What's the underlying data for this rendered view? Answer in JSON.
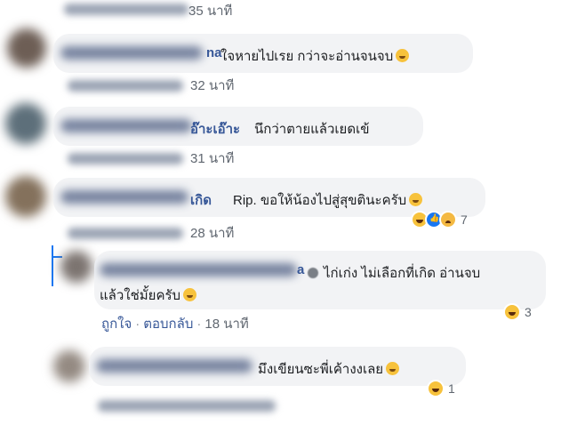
{
  "comments": [
    {
      "name_tail": "",
      "text": "",
      "time_fragment": "35 นาที"
    },
    {
      "name_tail": "na",
      "text": "ใจหายไปเรย กว่าจะอ่านจนจบ",
      "time_fragment": "32 นาที"
    },
    {
      "name_tail": "อ๊าะเอ๊าะ",
      "text": "นึกว่าตายแล้วเยดเข้",
      "time_fragment": "31 นาที"
    },
    {
      "name_tail": "เกิด",
      "text": "Rip. ขอให้น้องไปสู่สุขตินะครับ",
      "time_fragment": "28 นาที",
      "reaction_count": "7"
    },
    {
      "name_tail": "a",
      "text_line1": "ไก่เก่ง ไม่เลือกที่เกิด อ่านจบ",
      "text_line2": "แล้วใช่มั้ยครับ",
      "like_label": "ถูกใจ",
      "reply_label": "ตอบกลับ",
      "time": "18 นาที",
      "reaction_count": "3"
    },
    {
      "name_tail": "",
      "text": "มึงเขียนซะพี่เค้างงเลย",
      "reaction_count": "1"
    }
  ],
  "icons": {
    "haha": "haha-reaction-icon",
    "like": "like-reaction-icon",
    "sad": "sad-reaction-icon",
    "emoji": "grinning-emoji-icon"
  },
  "colors": {
    "bubble": "#f2f3f5",
    "name": "#385898",
    "meta": "#606770",
    "thread": "#1877f2"
  }
}
